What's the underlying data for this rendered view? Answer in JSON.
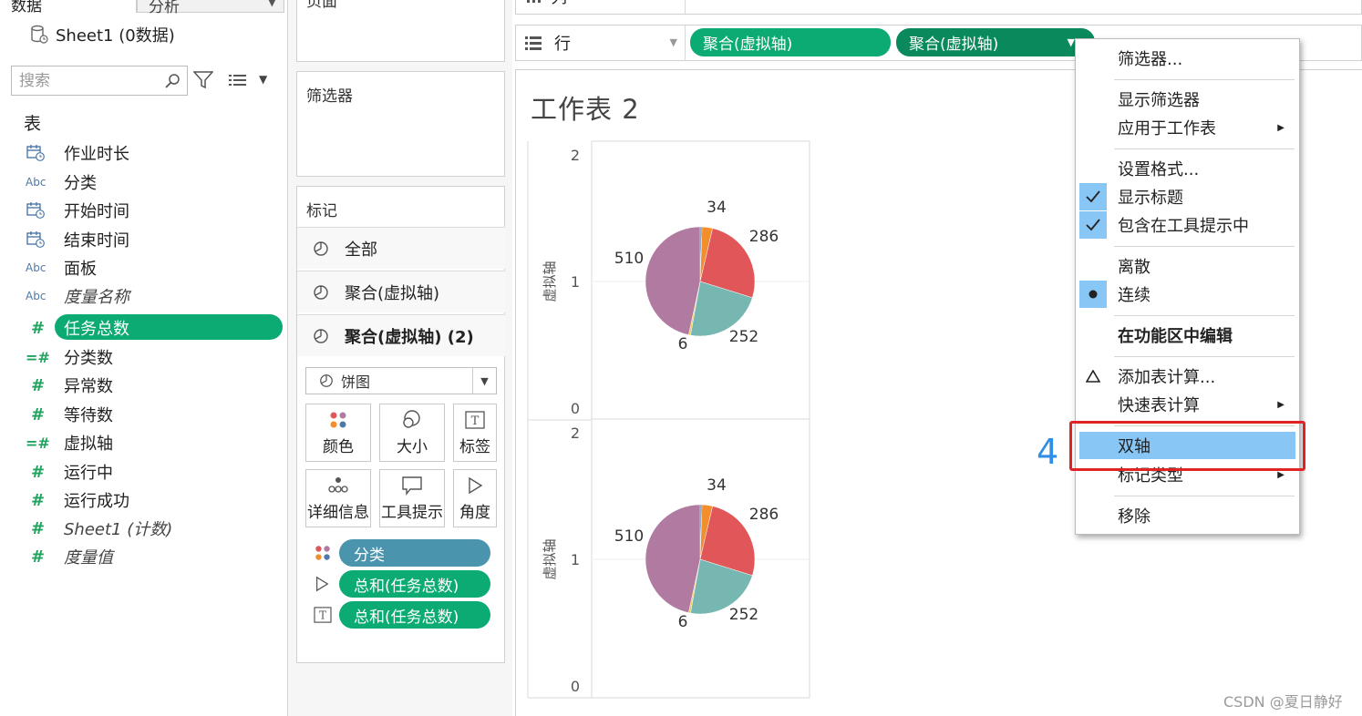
{
  "left_pane": {
    "tab_data": "数据",
    "tab_analysis": "分析",
    "source": "Sheet1 (0数据)",
    "search_placeholder": "搜索",
    "section": "表",
    "fields": [
      {
        "name": "作业时长",
        "type": "date"
      },
      {
        "name": "分类",
        "type": "Abc"
      },
      {
        "name": "开始时间",
        "type": "date"
      },
      {
        "name": "结束时间",
        "type": "date"
      },
      {
        "name": "面板",
        "type": "Abc"
      },
      {
        "name": "度量名称",
        "type": "Abc"
      },
      {
        "name": "任务总数",
        "type": "#"
      },
      {
        "name": "分类数",
        "type": "=#"
      },
      {
        "name": "异常数",
        "type": "#"
      },
      {
        "name": "等待数",
        "type": "#"
      },
      {
        "name": "虚拟轴",
        "type": "=#"
      },
      {
        "name": "运行中",
        "type": "#"
      },
      {
        "name": "运行成功",
        "type": "#"
      },
      {
        "name": "Sheet1 (计数)",
        "type": "#"
      },
      {
        "name": "度量值",
        "type": "#"
      }
    ]
  },
  "pages_panel": {
    "title": "页面"
  },
  "filters_panel": {
    "title": "筛选器"
  },
  "marks_panel": {
    "title": "标记",
    "rows": [
      "全部",
      "聚合(虚拟轴)",
      "聚合(虚拟轴) (2)"
    ],
    "mark_type": "饼图",
    "buttons": [
      "颜色",
      "大小",
      "标签",
      "详细信息",
      "工具提示",
      "角度"
    ],
    "pills": [
      "分类",
      "总和(任务总数)",
      "总和(任务总数)"
    ]
  },
  "shelves": {
    "columns_label": "列",
    "rows_label": "行",
    "row_pills": [
      "聚合(虚拟轴)",
      "聚合(虚拟轴)"
    ]
  },
  "viz": {
    "title": "工作表 2"
  },
  "chart_data": [
    {
      "type": "pie",
      "ylabel": "虚拟轴",
      "ylim": [
        0,
        2
      ],
      "yticks": [
        "2",
        "1",
        "0"
      ],
      "slices": [
        {
          "value": 6,
          "label": "6",
          "color": "#4e79a7"
        },
        {
          "value": 34,
          "label": "34",
          "color": "#f28e2b"
        },
        {
          "value": 286,
          "label": "286",
          "color": "#e15759"
        },
        {
          "value": 252,
          "label": "252",
          "color": "#76b7b2"
        },
        {
          "value": 6,
          "label": "6",
          "color": "#edc948"
        },
        {
          "value": 510,
          "label": "510",
          "color": "#b07aa1"
        }
      ]
    },
    {
      "type": "pie",
      "ylabel": "虚拟轴",
      "ylim": [
        0,
        2
      ],
      "yticks": [
        "2",
        "1",
        "0"
      ],
      "slices": [
        {
          "value": 6,
          "label": "6",
          "color": "#4e79a7"
        },
        {
          "value": 34,
          "label": "34",
          "color": "#f28e2b"
        },
        {
          "value": 286,
          "label": "286",
          "color": "#e15759"
        },
        {
          "value": 252,
          "label": "252",
          "color": "#76b7b2"
        },
        {
          "value": 6,
          "label": "6",
          "color": "#edc948"
        },
        {
          "value": 510,
          "label": "510",
          "color": "#b07aa1"
        }
      ]
    }
  ],
  "context_menu": {
    "items": [
      {
        "label": "筛选器...",
        "kind": "item"
      },
      {
        "kind": "sep"
      },
      {
        "label": "显示筛选器",
        "kind": "item"
      },
      {
        "label": "应用于工作表",
        "kind": "submenu"
      },
      {
        "kind": "sep"
      },
      {
        "label": "设置格式...",
        "kind": "item"
      },
      {
        "label": "显示标题",
        "kind": "check"
      },
      {
        "label": "包含在工具提示中",
        "kind": "check"
      },
      {
        "kind": "sep"
      },
      {
        "label": "离散",
        "kind": "item"
      },
      {
        "label": "连续",
        "kind": "radio"
      },
      {
        "kind": "sep"
      },
      {
        "label": "在功能区中编辑",
        "kind": "bold"
      },
      {
        "kind": "sep"
      },
      {
        "label": "添加表计算...",
        "kind": "delta"
      },
      {
        "label": "快速表计算",
        "kind": "submenu"
      },
      {
        "kind": "sep"
      },
      {
        "label": "双轴",
        "kind": "highlight"
      },
      {
        "label": "标记类型",
        "kind": "submenu"
      },
      {
        "kind": "sep"
      },
      {
        "label": "移除",
        "kind": "item"
      }
    ]
  },
  "annotation": {
    "step": "4"
  },
  "watermark": "CSDN @夏日静好",
  "colors": {
    "pill_green": "#0cab73",
    "pill_dark_green": "#0a8a5c",
    "pill_blue": "#4b94ad",
    "menu_highlight": "#88c6f5",
    "annotation_red": "#e02424",
    "step_blue": "#2f8fe6"
  }
}
